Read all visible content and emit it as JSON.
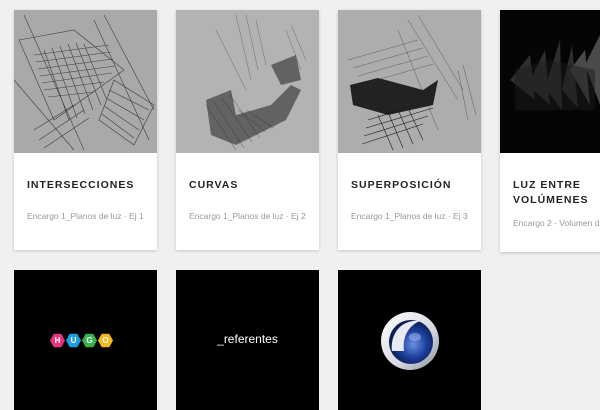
{
  "cards": [
    {
      "title": "INTERSECCIONES",
      "meta": "Encargo 1_Planos de luz · Ej 1"
    },
    {
      "title": "CURVAS",
      "meta": "Encargo 1_Planos de luz · Ej 2"
    },
    {
      "title": "SUPERPOSICIÓN",
      "meta": "Encargo 1_Planos de luz · Ej 3"
    },
    {
      "title": "LUZ ENTRE VOLÚMENES",
      "meta": "Encargo 2 - Volumen d"
    }
  ],
  "tiles": {
    "hugo": {
      "letters": [
        "H",
        "U",
        "G",
        "O"
      ],
      "colors": [
        "#e8327d",
        "#1e9de1",
        "#38b34a",
        "#f5b81c"
      ]
    },
    "referentes": {
      "label": "_referentes"
    },
    "cinema": {
      "icon": "cinema4d-logo-icon"
    }
  }
}
